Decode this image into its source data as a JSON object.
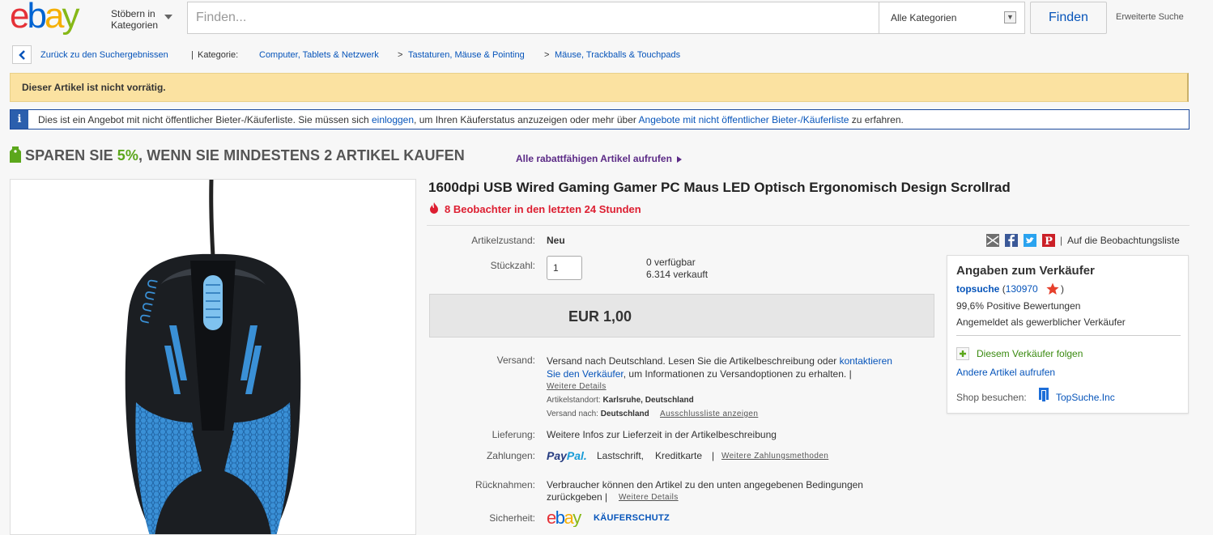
{
  "header": {
    "browse_line1": "Stöbern in",
    "browse_line2": "Kategorien",
    "search_placeholder": "Finden...",
    "category_selected": "Alle Kategorien",
    "find_button": "Finden",
    "advanced_search": "Erweiterte Suche"
  },
  "breadcrumb": {
    "back_text": "Zurück zu den Suchergebnissen",
    "separator": "|",
    "label": "Kategorie:",
    "items": [
      "Computer, Tablets & Netzwerk",
      "Tastaturen, Mäuse & Pointing",
      "Mäuse, Trackballs & Touchpads"
    ],
    "gt": ">"
  },
  "notices": {
    "out_of_stock": "Dieser Artikel ist nicht vorrätig.",
    "info_part1": "Dies ist ein Angebot mit nicht öffentlicher Bieter-/Käuferliste. Sie müssen sich ",
    "info_link1": "einloggen",
    "info_part2": ", um Ihren Käuferstatus anzuzeigen oder mehr über ",
    "info_link2": "Angebote mit nicht öffentlicher Bieter-/Käuferliste",
    "info_part3": " zu erfahren."
  },
  "promo": {
    "text_before": "SPAREN SIE ",
    "percent": "5%",
    "text_after": ", WENN SIE MINDESTENS 2 ARTIKEL KAUFEN",
    "link": "Alle rabattfähigen Artikel aufrufen"
  },
  "item": {
    "title": "1600dpi USB Wired Gaming Gamer PC Maus LED Optisch Ergonomisch Design Scrollrad",
    "watchers": "8 Beobachter in den letzten 24 Stunden",
    "condition_label": "Artikelzustand:",
    "condition_value": "Neu",
    "qty_label": "Stückzahl:",
    "qty_value": "1",
    "available": "0 verfügbar",
    "sold": "6.314 verkauft",
    "price": "EUR 1,00",
    "watchlist": "Auf die Beobachtungsliste",
    "watchlist_sep": "|",
    "shipping_label": "Versand:",
    "shipping_text1": "Versand nach Deutschland. Lesen Sie die Artikelbeschreibung oder ",
    "shipping_link_a": "kontaktieren",
    "shipping_link_b": "Sie den Verkäufer",
    "shipping_text2": ", um Informationen zu Versandoptionen zu erhalten. |",
    "shipping_details": "Weitere Details",
    "location_label": "Artikelstandort:",
    "location_value": "Karlsruhe, Deutschland",
    "ships_to_label": "Versand nach:",
    "ships_to_value": "Deutschland",
    "exclusion_link": "Ausschlussliste anzeigen",
    "delivery_label": "Lieferung:",
    "delivery_value": "Weitere Infos zur Lieferzeit in der Artikelbeschreibung",
    "payment_label": "Zahlungen:",
    "paypal_pay": "Pay",
    "paypal_pal": "Pal.",
    "payment_1": "Lastschrift,",
    "payment_2": "Kreditkarte",
    "payment_sep": "|",
    "payment_more": "Weitere Zahlungsmethoden",
    "returns_label": "Rücknahmen:",
    "returns_line1": "Verbraucher können den Artikel zu den unten angegebenen Bedingungen",
    "returns_line2": "zurückgeben |",
    "returns_details": "Weitere Details",
    "security_label": "Sicherheit:",
    "buyer_protection": "KÄUFERSCHUTZ"
  },
  "seller": {
    "heading": "Angaben zum Verkäufer",
    "name": "topsuche",
    "feedback_open": "(",
    "feedback_score": "130970",
    "feedback_close": ")",
    "positive": "99,6% Positive Bewertungen",
    "business": "Angemeldet als gewerblicher Verkäufer",
    "follow": "Diesem Verkäufer folgen",
    "other_items": "Andere Artikel aufrufen",
    "shop_label": "Shop besuchen:",
    "shop_name": "TopSuche.Inc"
  },
  "colors": {
    "ebay_e": "#e53238",
    "ebay_b": "#0064d2",
    "ebay_a": "#f5af02",
    "ebay_y": "#86b817",
    "link": "#0654ba",
    "notice": "#fbe2a1",
    "promo_green": "#5ba71b",
    "watchers_red": "#dd1e31"
  }
}
